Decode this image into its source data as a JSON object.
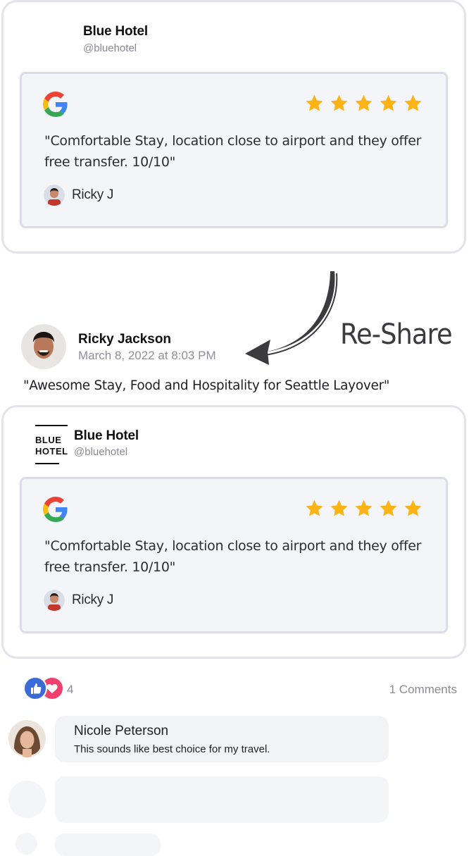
{
  "original_post": {
    "hotel_name": "Blue Hotel",
    "hotel_handle": "@bluehotel",
    "review": {
      "source_icon": "google-g-icon",
      "rating": 5,
      "text": "\"Comfortable Stay, location close to airport and they offer free transfer. 10/10\"",
      "reviewer_name": "Ricky J"
    }
  },
  "reshare_label": "Re-Share",
  "reshare_post": {
    "author_name": "Ricky Jackson",
    "timestamp": "March 8, 2022 at 8:03 PM",
    "caption": "\"Awesome Stay, Food and Hospitality for Seattle Layover\"",
    "logo_line1": "BLUE",
    "logo_line2": "HOTEL",
    "hotel_name": "Blue Hotel",
    "hotel_handle": "@bluehotel",
    "review": {
      "source_icon": "google-g-icon",
      "rating": 5,
      "text": "\"Comfortable Stay, location close to airport and they offer free transfer. 10/10\"",
      "reviewer_name": "Ricky J"
    }
  },
  "engagement": {
    "reaction_icons": [
      "like-icon",
      "love-icon"
    ],
    "reaction_count": "4",
    "comments_count": "1 Comments"
  },
  "comments": [
    {
      "author": "Nicole Peterson",
      "text": "This sounds like best choice for my travel."
    }
  ],
  "colors": {
    "star": "#FBB315",
    "like": "#3B6BD6",
    "love": "#F0416E",
    "card_border": "#E3E3EC",
    "review_bg": "#F4F5F8"
  }
}
